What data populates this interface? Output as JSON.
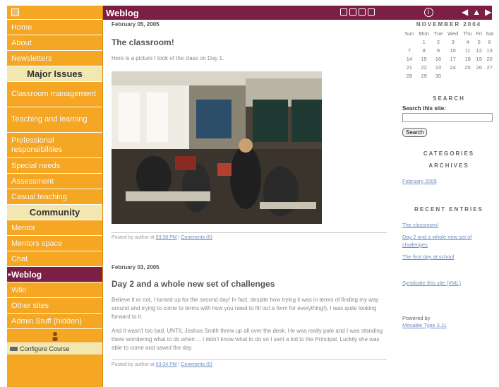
{
  "sidebar": {
    "items_a": [
      "Home",
      "About",
      "Newsletters"
    ],
    "heading_major": "Major Issues",
    "items_b": [
      "Classroom management",
      "Teaching and learning",
      "Professional responsibilities"
    ],
    "items_c": [
      "Special needs",
      "Assessment",
      "Casual teaching"
    ],
    "heading_community": "Community",
    "items_d": [
      "Mentor",
      "Mentors space",
      "Chat"
    ],
    "active": "Weblog",
    "items_e": [
      "Wiki",
      "Other sites",
      "Admin Stuff (hidden)"
    ],
    "configure_label": "Configure Course"
  },
  "topbar": {
    "title": "Weblog",
    "help_icon": "info-icon",
    "nav": [
      "◀",
      "▲",
      "▶"
    ]
  },
  "posts": [
    {
      "date": "February 05, 2005",
      "title": "The classroom!",
      "text": "Here is a picture I took of the class on Day 1.",
      "footer_prefix": "Posted by author at",
      "time": "03:38 PM",
      "separator": "|",
      "comments": "Comments (0)"
    },
    {
      "date": "February 03, 2005",
      "title": "Day 2 and a whole new set of challenges",
      "paragraphs": [
        "Believe it or not, I turned up for the second day! In fact, despite how trying it was in terms of finding my way around and trying to come to terms with how you need to fill out a form for everything!), I was quite looking forward to it.",
        "And it wasn't too bad, UNTIL Joshua Smith threw up all over the desk. He was really pale and I was standing there wondering what to do when ... I didn't know what to do so I sent a kid to the Principal. Luckily she was able to come and saved the day."
      ],
      "footer_prefix": "Posted by author at",
      "time": "03:34 PM",
      "separator": "|",
      "comments": "Comments (0)"
    }
  ],
  "calendar": {
    "title": "NOVEMBER 2004",
    "days": [
      "Sun",
      "Mon",
      "Tue",
      "Wed",
      "Thu",
      "Fri",
      "Sat"
    ],
    "weeks": [
      [
        "",
        "1",
        "2",
        "3",
        "4",
        "5",
        "6"
      ],
      [
        "7",
        "8",
        "9",
        "10",
        "11",
        "12",
        "13"
      ],
      [
        "14",
        "15",
        "16",
        "17",
        "18",
        "19",
        "20"
      ],
      [
        "21",
        "22",
        "23",
        "24",
        "25",
        "26",
        "27"
      ],
      [
        "28",
        "29",
        "30",
        "",
        "",
        "",
        ""
      ]
    ]
  },
  "search": {
    "heading": "SEARCH",
    "label": "Search this site:",
    "value": "",
    "button": "Search"
  },
  "categories_heading": "CATEGORIES",
  "archives": {
    "heading": "ARCHIVES",
    "links": [
      "February 2005"
    ]
  },
  "recent": {
    "heading": "RECENT ENTRIES",
    "links": [
      "The classroom!",
      "Day 2 and a whole new set of challenges",
      "The first day at school"
    ]
  },
  "syndicate": "Syndicate this site (XML)",
  "powered": {
    "label": "Powered by",
    "link": "Movable Type 3.11"
  },
  "colors": {
    "sidebar": "#f5a623",
    "accent": "#7b1f44",
    "heading_bg": "#f2e7b0",
    "link": "#6a8fc2"
  }
}
